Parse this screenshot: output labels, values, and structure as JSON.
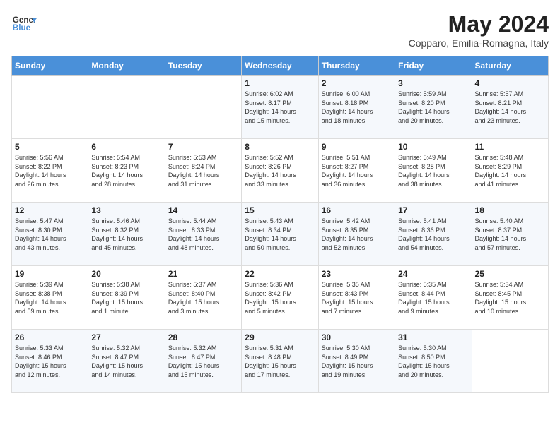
{
  "header": {
    "logo_line1": "General",
    "logo_line2": "Blue",
    "month_title": "May 2024",
    "subtitle": "Copparo, Emilia-Romagna, Italy"
  },
  "weekdays": [
    "Sunday",
    "Monday",
    "Tuesday",
    "Wednesday",
    "Thursday",
    "Friday",
    "Saturday"
  ],
  "weeks": [
    [
      {
        "day": "",
        "info": ""
      },
      {
        "day": "",
        "info": ""
      },
      {
        "day": "",
        "info": ""
      },
      {
        "day": "1",
        "info": "Sunrise: 6:02 AM\nSunset: 8:17 PM\nDaylight: 14 hours\nand 15 minutes."
      },
      {
        "day": "2",
        "info": "Sunrise: 6:00 AM\nSunset: 8:18 PM\nDaylight: 14 hours\nand 18 minutes."
      },
      {
        "day": "3",
        "info": "Sunrise: 5:59 AM\nSunset: 8:20 PM\nDaylight: 14 hours\nand 20 minutes."
      },
      {
        "day": "4",
        "info": "Sunrise: 5:57 AM\nSunset: 8:21 PM\nDaylight: 14 hours\nand 23 minutes."
      }
    ],
    [
      {
        "day": "5",
        "info": "Sunrise: 5:56 AM\nSunset: 8:22 PM\nDaylight: 14 hours\nand 26 minutes."
      },
      {
        "day": "6",
        "info": "Sunrise: 5:54 AM\nSunset: 8:23 PM\nDaylight: 14 hours\nand 28 minutes."
      },
      {
        "day": "7",
        "info": "Sunrise: 5:53 AM\nSunset: 8:24 PM\nDaylight: 14 hours\nand 31 minutes."
      },
      {
        "day": "8",
        "info": "Sunrise: 5:52 AM\nSunset: 8:26 PM\nDaylight: 14 hours\nand 33 minutes."
      },
      {
        "day": "9",
        "info": "Sunrise: 5:51 AM\nSunset: 8:27 PM\nDaylight: 14 hours\nand 36 minutes."
      },
      {
        "day": "10",
        "info": "Sunrise: 5:49 AM\nSunset: 8:28 PM\nDaylight: 14 hours\nand 38 minutes."
      },
      {
        "day": "11",
        "info": "Sunrise: 5:48 AM\nSunset: 8:29 PM\nDaylight: 14 hours\nand 41 minutes."
      }
    ],
    [
      {
        "day": "12",
        "info": "Sunrise: 5:47 AM\nSunset: 8:30 PM\nDaylight: 14 hours\nand 43 minutes."
      },
      {
        "day": "13",
        "info": "Sunrise: 5:46 AM\nSunset: 8:32 PM\nDaylight: 14 hours\nand 45 minutes."
      },
      {
        "day": "14",
        "info": "Sunrise: 5:44 AM\nSunset: 8:33 PM\nDaylight: 14 hours\nand 48 minutes."
      },
      {
        "day": "15",
        "info": "Sunrise: 5:43 AM\nSunset: 8:34 PM\nDaylight: 14 hours\nand 50 minutes."
      },
      {
        "day": "16",
        "info": "Sunrise: 5:42 AM\nSunset: 8:35 PM\nDaylight: 14 hours\nand 52 minutes."
      },
      {
        "day": "17",
        "info": "Sunrise: 5:41 AM\nSunset: 8:36 PM\nDaylight: 14 hours\nand 54 minutes."
      },
      {
        "day": "18",
        "info": "Sunrise: 5:40 AM\nSunset: 8:37 PM\nDaylight: 14 hours\nand 57 minutes."
      }
    ],
    [
      {
        "day": "19",
        "info": "Sunrise: 5:39 AM\nSunset: 8:38 PM\nDaylight: 14 hours\nand 59 minutes."
      },
      {
        "day": "20",
        "info": "Sunrise: 5:38 AM\nSunset: 8:39 PM\nDaylight: 15 hours\nand 1 minute."
      },
      {
        "day": "21",
        "info": "Sunrise: 5:37 AM\nSunset: 8:40 PM\nDaylight: 15 hours\nand 3 minutes."
      },
      {
        "day": "22",
        "info": "Sunrise: 5:36 AM\nSunset: 8:42 PM\nDaylight: 15 hours\nand 5 minutes."
      },
      {
        "day": "23",
        "info": "Sunrise: 5:35 AM\nSunset: 8:43 PM\nDaylight: 15 hours\nand 7 minutes."
      },
      {
        "day": "24",
        "info": "Sunrise: 5:35 AM\nSunset: 8:44 PM\nDaylight: 15 hours\nand 9 minutes."
      },
      {
        "day": "25",
        "info": "Sunrise: 5:34 AM\nSunset: 8:45 PM\nDaylight: 15 hours\nand 10 minutes."
      }
    ],
    [
      {
        "day": "26",
        "info": "Sunrise: 5:33 AM\nSunset: 8:46 PM\nDaylight: 15 hours\nand 12 minutes."
      },
      {
        "day": "27",
        "info": "Sunrise: 5:32 AM\nSunset: 8:47 PM\nDaylight: 15 hours\nand 14 minutes."
      },
      {
        "day": "28",
        "info": "Sunrise: 5:32 AM\nSunset: 8:47 PM\nDaylight: 15 hours\nand 15 minutes."
      },
      {
        "day": "29",
        "info": "Sunrise: 5:31 AM\nSunset: 8:48 PM\nDaylight: 15 hours\nand 17 minutes."
      },
      {
        "day": "30",
        "info": "Sunrise: 5:30 AM\nSunset: 8:49 PM\nDaylight: 15 hours\nand 19 minutes."
      },
      {
        "day": "31",
        "info": "Sunrise: 5:30 AM\nSunset: 8:50 PM\nDaylight: 15 hours\nand 20 minutes."
      },
      {
        "day": "",
        "info": ""
      }
    ]
  ]
}
